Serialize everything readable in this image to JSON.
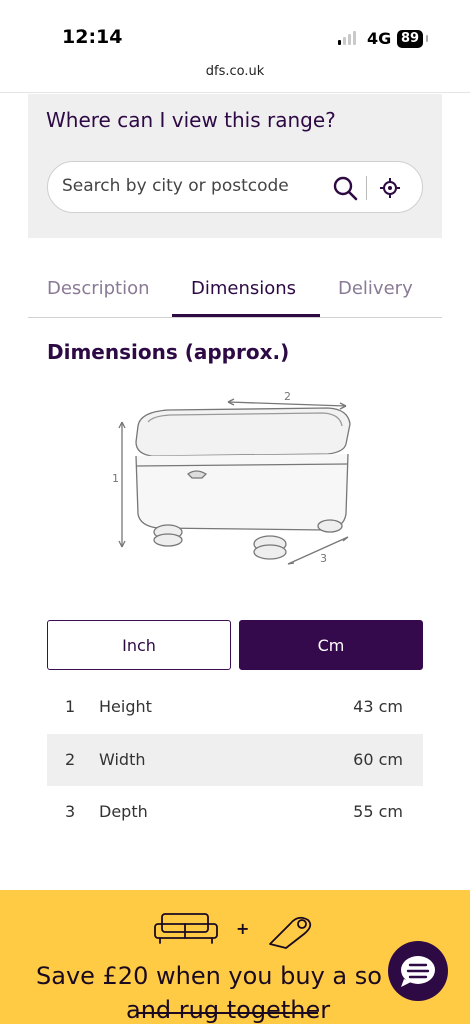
{
  "status_bar": {
    "time": "12:14",
    "network": "4G",
    "battery": "89"
  },
  "browser": {
    "url": "dfs.co.uk"
  },
  "store_locator": {
    "title": "Where can I view this range?",
    "search_placeholder": "Search by city or postcode"
  },
  "tabs": [
    {
      "label": "Description",
      "active": false
    },
    {
      "label": "Dimensions",
      "active": true
    },
    {
      "label": "Delivery",
      "active": false
    }
  ],
  "dimensions": {
    "title": "Dimensions (approx.)",
    "diagram_labels": [
      "1",
      "2",
      "3"
    ],
    "units": {
      "inch_label": "Inch",
      "cm_label": "Cm",
      "selected": "Cm"
    },
    "rows": [
      {
        "num": "1",
        "name": "Height",
        "value": "43 cm"
      },
      {
        "num": "2",
        "name": "Width",
        "value": "60 cm"
      },
      {
        "num": "3",
        "name": "Depth",
        "value": "55 cm"
      }
    ]
  },
  "promo": {
    "text_line1": "Save £20 when you buy a so",
    "text_line2": "and rug together",
    "plus": "+"
  },
  "colors": {
    "brand_purple": "#350a4c",
    "promo_yellow": "#ffcb45"
  }
}
